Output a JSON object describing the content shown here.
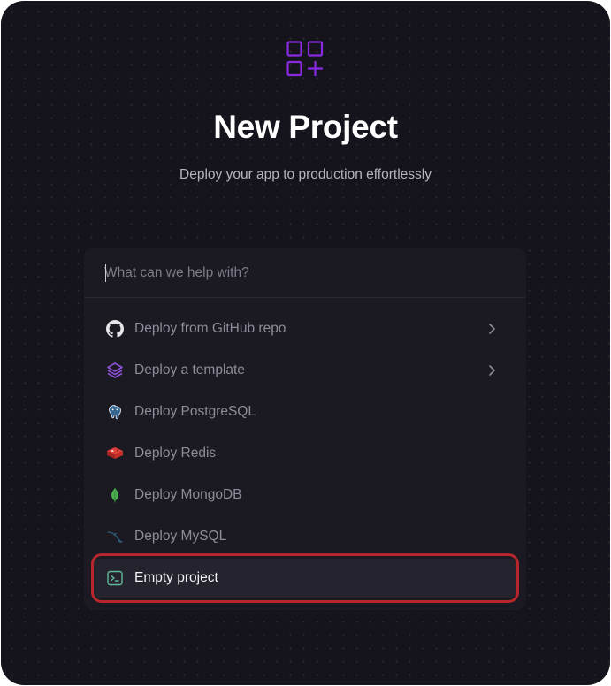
{
  "header": {
    "logo_icon": "grid-plus-icon",
    "title": "New Project",
    "subtitle": "Deploy your app to production effortlessly"
  },
  "search": {
    "placeholder": "What can we help with?",
    "value": ""
  },
  "menu": {
    "items": [
      {
        "label": "Deploy from GitHub repo",
        "icon": "github-icon",
        "has_submenu": true
      },
      {
        "label": "Deploy a template",
        "icon": "layers-icon",
        "has_submenu": true
      },
      {
        "label": "Deploy PostgreSQL",
        "icon": "postgresql-icon",
        "has_submenu": false
      },
      {
        "label": "Deploy Redis",
        "icon": "redis-icon",
        "has_submenu": false
      },
      {
        "label": "Deploy MongoDB",
        "icon": "mongodb-icon",
        "has_submenu": false
      },
      {
        "label": "Deploy MySQL",
        "icon": "mysql-icon",
        "has_submenu": false
      },
      {
        "label": "Empty project",
        "icon": "terminal-icon",
        "has_submenu": false,
        "selected": true
      }
    ]
  },
  "colors": {
    "accent": "#8a2be2",
    "background": "#15131b",
    "panel": "#1b1922",
    "highlight_border": "#b8262c"
  }
}
